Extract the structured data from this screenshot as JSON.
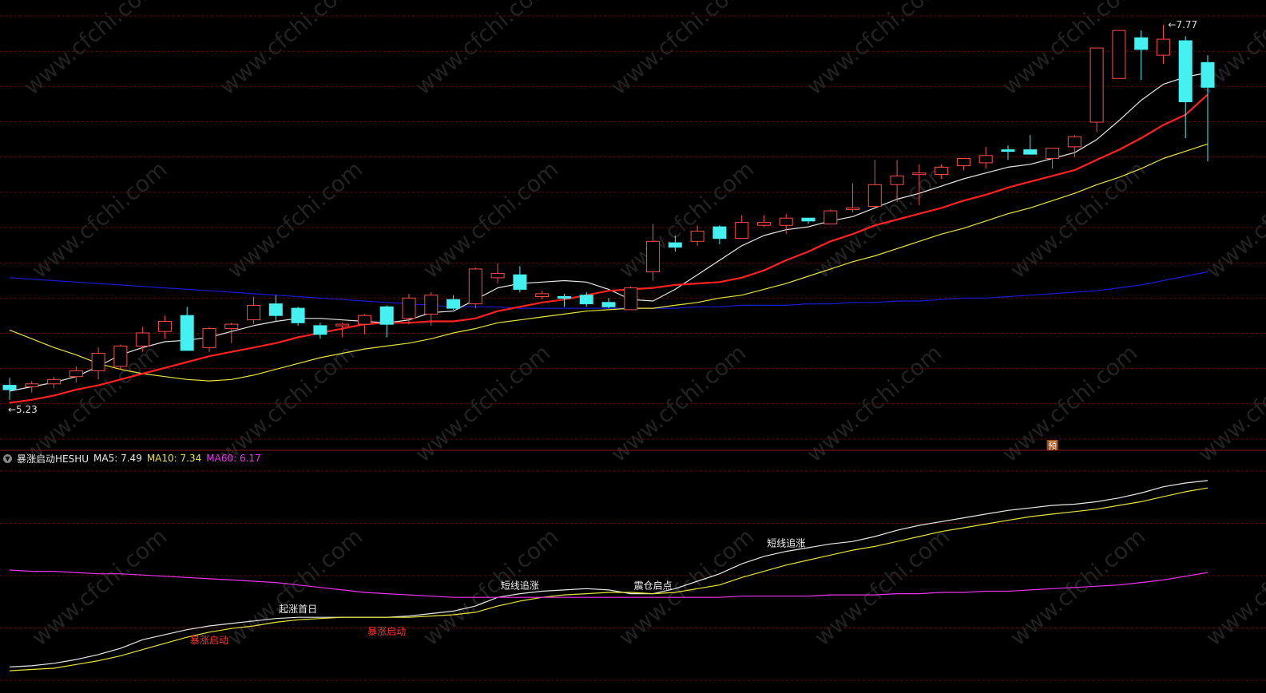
{
  "colors": {
    "background": "#000000",
    "grid": "#5a0e0e",
    "divider": "#8a1a1a",
    "up": "#ff4a4a",
    "down": "#44f0f0",
    "ma5": "#e6e6e6",
    "ma10": "#ff2020",
    "ma20": "#e8e33a",
    "ma60": "#1a1ad6",
    "ind_ma5": "#e8e8e8",
    "ind_ma10": "#e8e33a",
    "ind_ma60": "#ee33ee",
    "signal_red": "#ff3030",
    "signal_white": "#f0f0f0"
  },
  "indicator": {
    "icon": "chevron-down-icon",
    "name": "暴涨启动HESHU",
    "ma5_label": "MA5:",
    "ma5_value": "7.49",
    "ma10_label": "MA10:",
    "ma10_value": "7.34",
    "ma60_label": "MA60:",
    "ma60_value": "6.17"
  },
  "chart_data": [
    {
      "type": "candlestick",
      "ylim": [
        4.97,
        7.88
      ],
      "high_label": "7.77",
      "low_label": "5.23",
      "marker": "预",
      "candles": [
        {
          "o": 5.34,
          "h": 5.39,
          "l": 5.24,
          "c": 5.31
        },
        {
          "o": 5.33,
          "h": 5.37,
          "l": 5.29,
          "c": 5.35
        },
        {
          "o": 5.35,
          "h": 5.4,
          "l": 5.32,
          "c": 5.38
        },
        {
          "o": 5.4,
          "h": 5.47,
          "l": 5.36,
          "c": 5.44
        },
        {
          "o": 5.44,
          "h": 5.6,
          "l": 5.38,
          "c": 5.56
        },
        {
          "o": 5.47,
          "h": 5.62,
          "l": 5.45,
          "c": 5.61
        },
        {
          "o": 5.61,
          "h": 5.74,
          "l": 5.57,
          "c": 5.7
        },
        {
          "o": 5.71,
          "h": 5.82,
          "l": 5.66,
          "c": 5.78
        },
        {
          "o": 5.82,
          "h": 5.88,
          "l": 5.61,
          "c": 5.58
        },
        {
          "o": 5.6,
          "h": 5.74,
          "l": 5.57,
          "c": 5.73
        },
        {
          "o": 5.73,
          "h": 5.77,
          "l": 5.63,
          "c": 5.76
        },
        {
          "o": 5.79,
          "h": 5.95,
          "l": 5.76,
          "c": 5.89
        },
        {
          "o": 5.9,
          "h": 5.96,
          "l": 5.78,
          "c": 5.82
        },
        {
          "o": 5.87,
          "h": 5.88,
          "l": 5.75,
          "c": 5.77
        },
        {
          "o": 5.75,
          "h": 5.77,
          "l": 5.66,
          "c": 5.69
        },
        {
          "o": 5.75,
          "h": 5.77,
          "l": 5.67,
          "c": 5.76
        },
        {
          "o": 5.76,
          "h": 5.83,
          "l": 5.69,
          "c": 5.82
        },
        {
          "o": 5.88,
          "h": 5.89,
          "l": 5.67,
          "c": 5.76
        },
        {
          "o": 5.8,
          "h": 5.97,
          "l": 5.76,
          "c": 5.94
        },
        {
          "o": 5.83,
          "h": 5.98,
          "l": 5.75,
          "c": 5.96
        },
        {
          "o": 5.93,
          "h": 5.96,
          "l": 5.86,
          "c": 5.87
        },
        {
          "o": 5.9,
          "h": 6.15,
          "l": 5.87,
          "c": 6.14
        },
        {
          "o": 6.08,
          "h": 6.18,
          "l": 6.04,
          "c": 6.11
        },
        {
          "o": 6.1,
          "h": 6.16,
          "l": 5.98,
          "c": 6.0
        },
        {
          "o": 5.95,
          "h": 5.99,
          "l": 5.93,
          "c": 5.97
        },
        {
          "o": 5.95,
          "h": 5.97,
          "l": 5.88,
          "c": 5.94
        },
        {
          "o": 5.96,
          "h": 5.98,
          "l": 5.88,
          "c": 5.9
        },
        {
          "o": 5.91,
          "h": 5.94,
          "l": 5.87,
          "c": 5.88
        },
        {
          "o": 5.86,
          "h": 6.02,
          "l": 5.86,
          "c": 6.01
        },
        {
          "o": 6.12,
          "h": 6.45,
          "l": 6.06,
          "c": 6.33
        },
        {
          "o": 6.32,
          "h": 6.37,
          "l": 6.26,
          "c": 6.29
        },
        {
          "o": 6.33,
          "h": 6.44,
          "l": 6.3,
          "c": 6.4
        },
        {
          "o": 6.43,
          "h": 6.44,
          "l": 6.31,
          "c": 6.35
        },
        {
          "o": 6.35,
          "h": 6.51,
          "l": 6.35,
          "c": 6.46
        },
        {
          "o": 6.44,
          "h": 6.51,
          "l": 6.43,
          "c": 6.46
        },
        {
          "o": 6.44,
          "h": 6.52,
          "l": 6.38,
          "c": 6.49
        },
        {
          "o": 6.49,
          "h": 6.49,
          "l": 6.45,
          "c": 6.47
        },
        {
          "o": 6.45,
          "h": 6.55,
          "l": 6.45,
          "c": 6.54
        },
        {
          "o": 6.55,
          "h": 6.73,
          "l": 6.53,
          "c": 6.56
        },
        {
          "o": 6.57,
          "h": 6.89,
          "l": 6.55,
          "c": 6.72
        },
        {
          "o": 6.72,
          "h": 6.89,
          "l": 6.6,
          "c": 6.78
        },
        {
          "o": 6.8,
          "h": 6.86,
          "l": 6.58,
          "c": 6.8
        },
        {
          "o": 6.79,
          "h": 6.86,
          "l": 6.76,
          "c": 6.84
        },
        {
          "o": 6.85,
          "h": 6.87,
          "l": 6.82,
          "c": 6.9
        },
        {
          "o": 6.87,
          "h": 6.98,
          "l": 6.83,
          "c": 6.92
        },
        {
          "o": 6.96,
          "h": 6.99,
          "l": 6.89,
          "c": 6.95
        },
        {
          "o": 6.96,
          "h": 7.06,
          "l": 6.93,
          "c": 6.93
        },
        {
          "o": 6.9,
          "h": 6.97,
          "l": 6.83,
          "c": 6.97
        },
        {
          "o": 6.98,
          "h": 7.06,
          "l": 6.91,
          "c": 7.05
        },
        {
          "o": 7.15,
          "h": 7.43,
          "l": 7.08,
          "c": 7.66
        },
        {
          "o": 7.45,
          "h": 7.77,
          "l": 7.58,
          "c": 7.78
        },
        {
          "o": 7.73,
          "h": 7.78,
          "l": 7.44,
          "c": 7.65
        },
        {
          "o": 7.61,
          "h": 7.82,
          "l": 7.55,
          "c": 7.72
        },
        {
          "o": 7.71,
          "h": 7.74,
          "l": 7.04,
          "c": 7.29
        },
        {
          "o": 7.56,
          "h": 7.61,
          "l": 6.88,
          "c": 7.39
        }
      ],
      "ma5": [
        5.3,
        5.33,
        5.36,
        5.4,
        5.47,
        5.55,
        5.6,
        5.64,
        5.65,
        5.67,
        5.71,
        5.75,
        5.78,
        5.8,
        5.8,
        5.79,
        5.78,
        5.77,
        5.79,
        5.84,
        5.85,
        5.93,
        6.01,
        6.04,
        6.05,
        6.06,
        6.05,
        6.0,
        5.93,
        5.92,
        6.0,
        6.1,
        6.2,
        6.3,
        6.37,
        6.41,
        6.43,
        6.47,
        6.5,
        6.56,
        6.62,
        6.66,
        6.71,
        6.76,
        6.8,
        6.84,
        6.86,
        6.9,
        6.94,
        7.03,
        7.16,
        7.3,
        7.41,
        7.46,
        7.49
      ],
      "ma10": [
        5.22,
        5.24,
        5.27,
        5.31,
        5.34,
        5.38,
        5.42,
        5.46,
        5.5,
        5.54,
        5.57,
        5.6,
        5.63,
        5.67,
        5.7,
        5.73,
        5.76,
        5.77,
        5.77,
        5.78,
        5.78,
        5.8,
        5.85,
        5.88,
        5.91,
        5.93,
        5.96,
        5.99,
        6.0,
        6.01,
        6.03,
        6.04,
        6.05,
        6.08,
        6.13,
        6.2,
        6.26,
        6.33,
        6.38,
        6.44,
        6.48,
        6.52,
        6.56,
        6.61,
        6.65,
        6.7,
        6.74,
        6.78,
        6.82,
        6.89,
        6.96,
        7.04,
        7.13,
        7.2,
        7.34
      ],
      "ma20": [
        5.72,
        5.66,
        5.6,
        5.55,
        5.49,
        5.45,
        5.42,
        5.4,
        5.38,
        5.37,
        5.38,
        5.41,
        5.45,
        5.49,
        5.53,
        5.56,
        5.59,
        5.61,
        5.63,
        5.66,
        5.7,
        5.73,
        5.77,
        5.79,
        5.81,
        5.83,
        5.85,
        5.86,
        5.87,
        5.87,
        5.89,
        5.91,
        5.94,
        5.96,
        6.0,
        6.04,
        6.09,
        6.14,
        6.19,
        6.23,
        6.28,
        6.33,
        6.38,
        6.42,
        6.47,
        6.52,
        6.56,
        6.61,
        6.66,
        6.72,
        6.77,
        6.83,
        6.9,
        6.95,
        7.0
      ],
      "ma60": [
        6.08,
        6.07,
        6.06,
        6.05,
        6.04,
        6.03,
        6.02,
        6.01,
        6.0,
        5.99,
        5.98,
        5.97,
        5.96,
        5.95,
        5.94,
        5.93,
        5.92,
        5.91,
        5.9,
        5.89,
        5.88,
        5.88,
        5.88,
        5.87,
        5.87,
        5.87,
        5.87,
        5.87,
        5.87,
        5.87,
        5.87,
        5.88,
        5.88,
        5.89,
        5.89,
        5.89,
        5.9,
        5.9,
        5.91,
        5.91,
        5.92,
        5.92,
        5.93,
        5.94,
        5.94,
        5.95,
        5.96,
        5.97,
        5.98,
        5.99,
        6.01,
        6.03,
        6.06,
        6.09,
        6.12
      ]
    },
    {
      "type": "line",
      "title": "暴涨启动HESHU",
      "series": [
        {
          "name": "MA5",
          "values": [
            5.3,
            5.31,
            5.33,
            5.36,
            5.4,
            5.45,
            5.52,
            5.56,
            5.6,
            5.63,
            5.65,
            5.67,
            5.69,
            5.7,
            5.7,
            5.7,
            5.7,
            5.7,
            5.71,
            5.73,
            5.75,
            5.79,
            5.86,
            5.89,
            5.91,
            5.92,
            5.93,
            5.92,
            5.89,
            5.89,
            5.93,
            5.99,
            6.05,
            6.13,
            6.19,
            6.23,
            6.26,
            6.29,
            6.31,
            6.35,
            6.4,
            6.44,
            6.47,
            6.5,
            6.53,
            6.56,
            6.58,
            6.6,
            6.61,
            6.63,
            6.66,
            6.7,
            6.75,
            6.78,
            6.8
          ]
        },
        {
          "name": "MA10",
          "values": [
            5.27,
            5.28,
            5.29,
            5.32,
            5.35,
            5.39,
            5.44,
            5.49,
            5.54,
            5.58,
            5.61,
            5.63,
            5.66,
            5.68,
            5.69,
            5.7,
            5.7,
            5.7,
            5.7,
            5.71,
            5.72,
            5.74,
            5.79,
            5.83,
            5.86,
            5.88,
            5.89,
            5.9,
            5.9,
            5.89,
            5.9,
            5.93,
            5.96,
            6.02,
            6.07,
            6.12,
            6.16,
            6.2,
            6.24,
            6.27,
            6.31,
            6.35,
            6.39,
            6.42,
            6.45,
            6.48,
            6.51,
            6.53,
            6.55,
            6.57,
            6.6,
            6.63,
            6.67,
            6.71,
            6.74
          ]
        },
        {
          "name": "MA60",
          "values": [
            6.08,
            6.07,
            6.07,
            6.06,
            6.05,
            6.05,
            6.04,
            6.03,
            6.02,
            6.01,
            6.0,
            5.99,
            5.98,
            5.96,
            5.94,
            5.92,
            5.9,
            5.89,
            5.88,
            5.87,
            5.86,
            5.86,
            5.86,
            5.86,
            5.86,
            5.86,
            5.86,
            5.86,
            5.86,
            5.86,
            5.86,
            5.86,
            5.86,
            5.87,
            5.87,
            5.87,
            5.87,
            5.88,
            5.88,
            5.88,
            5.89,
            5.89,
            5.9,
            5.9,
            5.91,
            5.91,
            5.92,
            5.93,
            5.94,
            5.95,
            5.96,
            5.98,
            6.0,
            6.03,
            6.06
          ]
        }
      ],
      "annotations": [
        {
          "text": "起涨首日",
          "index": 13,
          "color": "white"
        },
        {
          "text": "暴涨启动",
          "index": 9,
          "color": "red"
        },
        {
          "text": "暴涨启动",
          "index": 17,
          "color": "red"
        },
        {
          "text": "短线追涨",
          "index": 23,
          "color": "white"
        },
        {
          "text": "震仓启点",
          "index": 29,
          "color": "white"
        },
        {
          "text": "短线追涨",
          "index": 35,
          "color": "white"
        }
      ]
    }
  ],
  "watermark": "www.cfchi.com"
}
